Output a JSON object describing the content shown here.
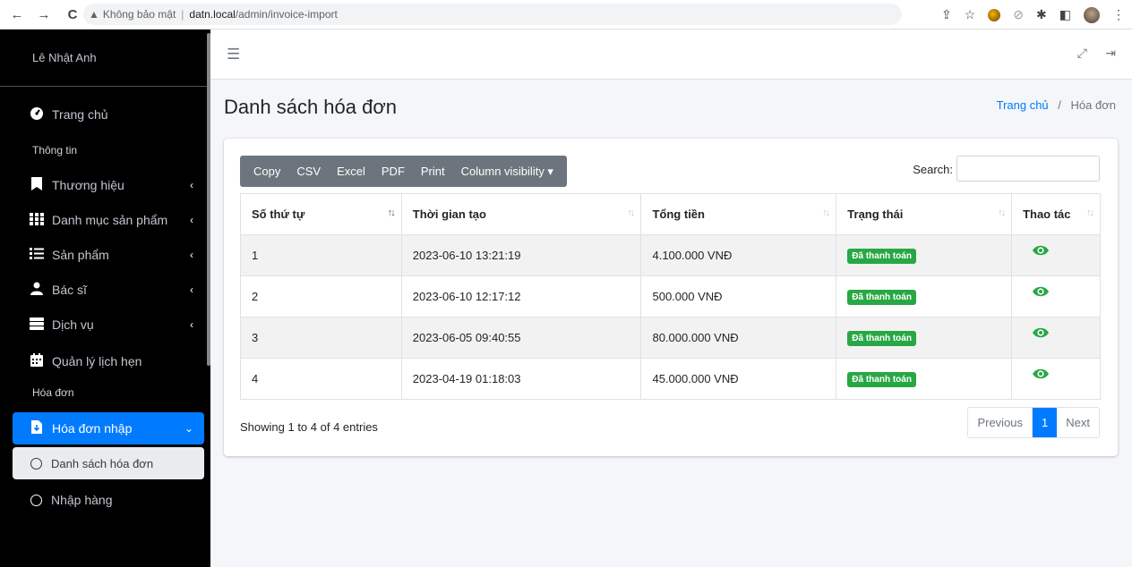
{
  "browser": {
    "back": "←",
    "forward": "→",
    "reload": "C",
    "insecure_label": "Không bảo mật",
    "url_host": "datn.local",
    "url_path": "/admin/invoice-import"
  },
  "sidebar": {
    "user_name": "Lê Nhật Anh",
    "home": "Trang chủ",
    "section_info": "Thông tin",
    "items": [
      {
        "label": "Thương hiệu"
      },
      {
        "label": "Danh mục sản phẩm"
      },
      {
        "label": "Sản phẩm"
      },
      {
        "label": "Bác sĩ"
      },
      {
        "label": "Dịch vụ"
      },
      {
        "label": "Quản lý lịch hẹn"
      }
    ],
    "section_invoice": "Hóa đơn",
    "invoice_import": "Hóa đơn nhập",
    "invoice_list": "Danh sách hóa đơn",
    "import_goods": "Nhập hàng"
  },
  "page": {
    "title": "Danh sách hóa đơn",
    "breadcrumb_home": "Trang chủ",
    "breadcrumb_sep": "/",
    "breadcrumb_current": "Hóa đơn"
  },
  "toolbar": {
    "copy": "Copy",
    "csv": "CSV",
    "excel": "Excel",
    "pdf": "PDF",
    "print": "Print",
    "colvis": "Column visibility ▾",
    "search_label": "Search:",
    "search_value": ""
  },
  "table": {
    "headers": [
      "Số thứ tự",
      "Thời gian tạo",
      "Tổng tiền",
      "Trạng thái",
      "Thao tác"
    ],
    "rows": [
      {
        "no": "1",
        "time": "2023-06-10 13:21:19",
        "total": "4.100.000 VNĐ",
        "status": "Đã thanh toán"
      },
      {
        "no": "2",
        "time": "2023-06-10 12:17:12",
        "total": "500.000 VNĐ",
        "status": "Đã thanh toán"
      },
      {
        "no": "3",
        "time": "2023-06-05 09:40:55",
        "total": "80.000.000 VNĐ",
        "status": "Đã thanh toán"
      },
      {
        "no": "4",
        "time": "2023-04-19 01:18:03",
        "total": "45.000.000 VNĐ",
        "status": "Đã thanh toán"
      }
    ]
  },
  "footer": {
    "info": "Showing 1 to 4 of 4 entries",
    "previous": "Previous",
    "page": "1",
    "next": "Next"
  },
  "colors": {
    "primary": "#007bff",
    "success": "#28a745",
    "sidebar_bg": "#000000",
    "toolbar_bg": "#6c757d"
  }
}
